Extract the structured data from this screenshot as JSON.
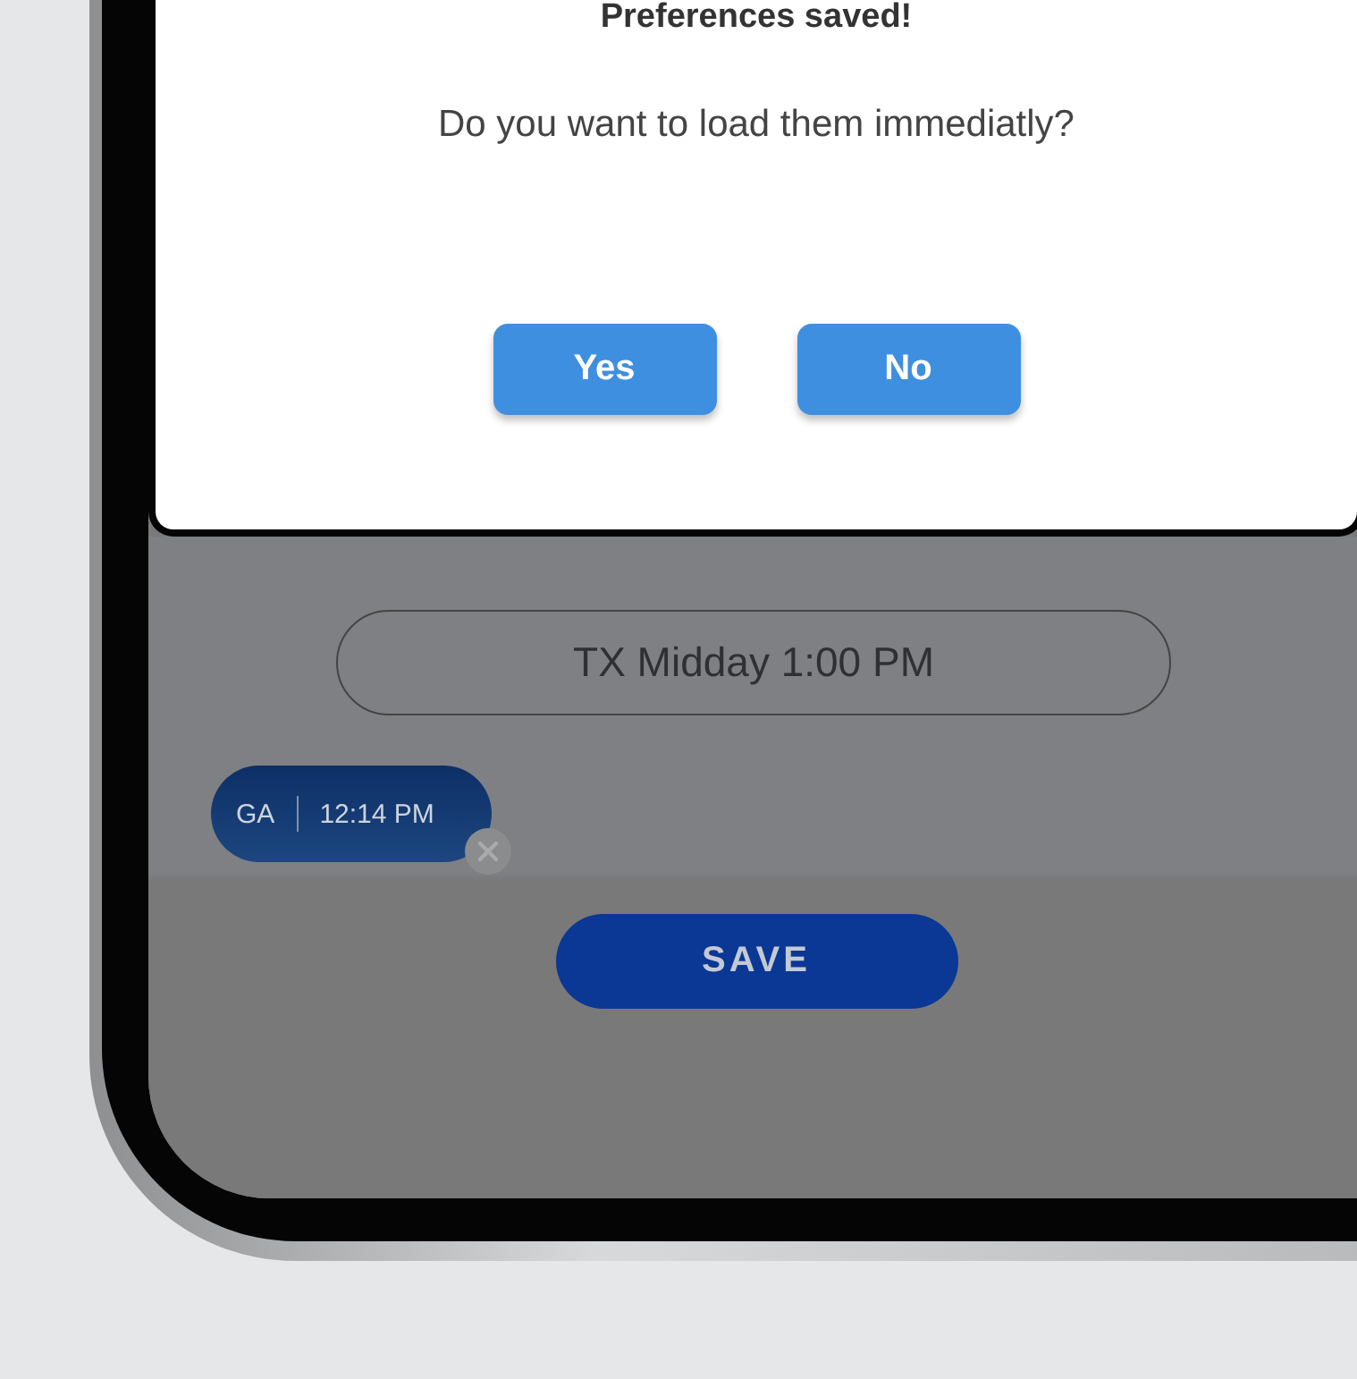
{
  "dialog": {
    "title": "Preferences saved!",
    "message": "Do you want to load them immediatly?",
    "buttons": [
      "Yes",
      "No"
    ]
  },
  "time_field": {
    "value": "TX Midday 1:00 PM"
  },
  "chips": [
    {
      "state": "GA",
      "time": "12:14 PM"
    }
  ],
  "save_button": "SAVE"
}
